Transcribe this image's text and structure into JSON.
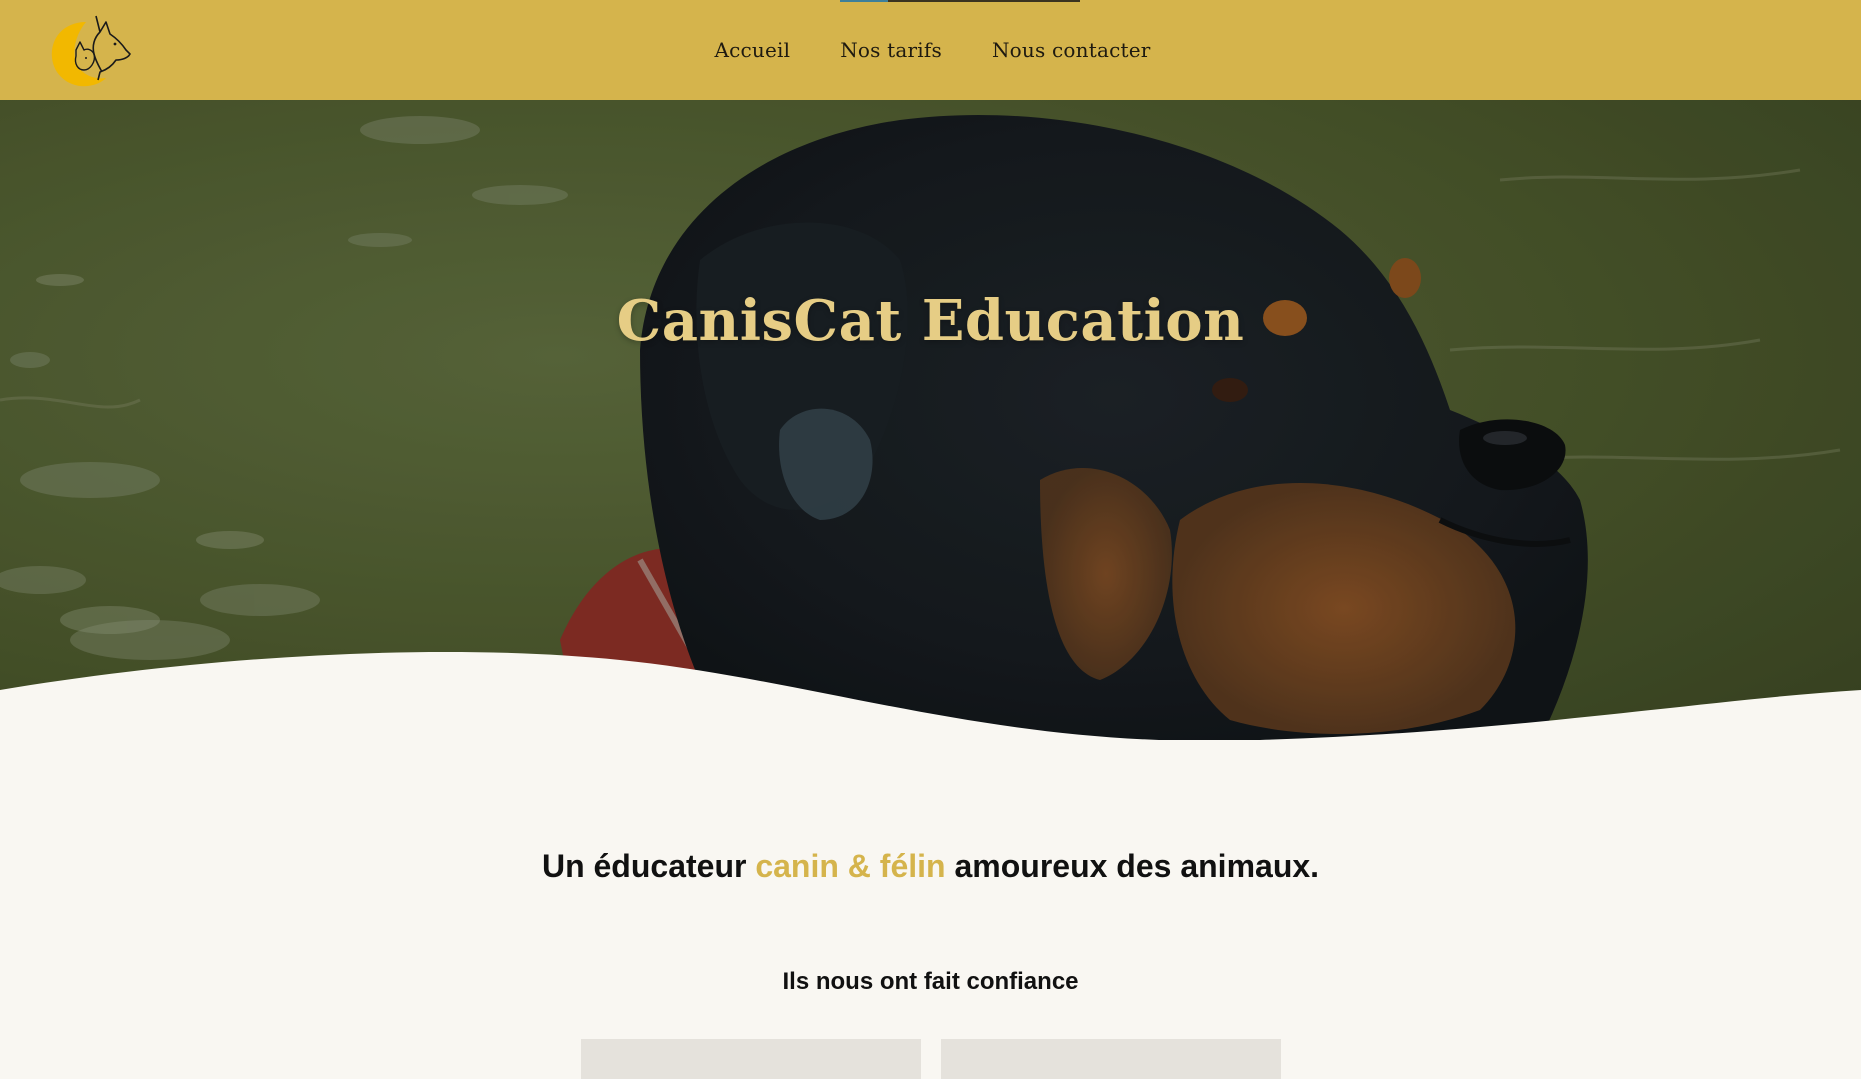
{
  "header": {
    "logo_icon": "dog-cat-logo-icon",
    "nav": [
      {
        "label": "Accueil"
      },
      {
        "label": "Nos tarifs"
      },
      {
        "label": "Nous contacter"
      }
    ]
  },
  "hero": {
    "title": "CanisCat Education",
    "image": "rottweiler-in-water-image"
  },
  "main": {
    "tagline_before": "Un éducateur ",
    "tagline_highlight": "canin & félin",
    "tagline_after": " amoureux des animaux.",
    "trust_title": "Ils nous ont fait confiance",
    "partners": [
      {
        "name": "partner-card-1"
      },
      {
        "name": "partner-card-2"
      }
    ]
  },
  "colors": {
    "brand_gold": "#d5b44c",
    "title_gold": "#e6cd85",
    "page_background": "#f9f7f2",
    "text_dark": "#111111"
  }
}
